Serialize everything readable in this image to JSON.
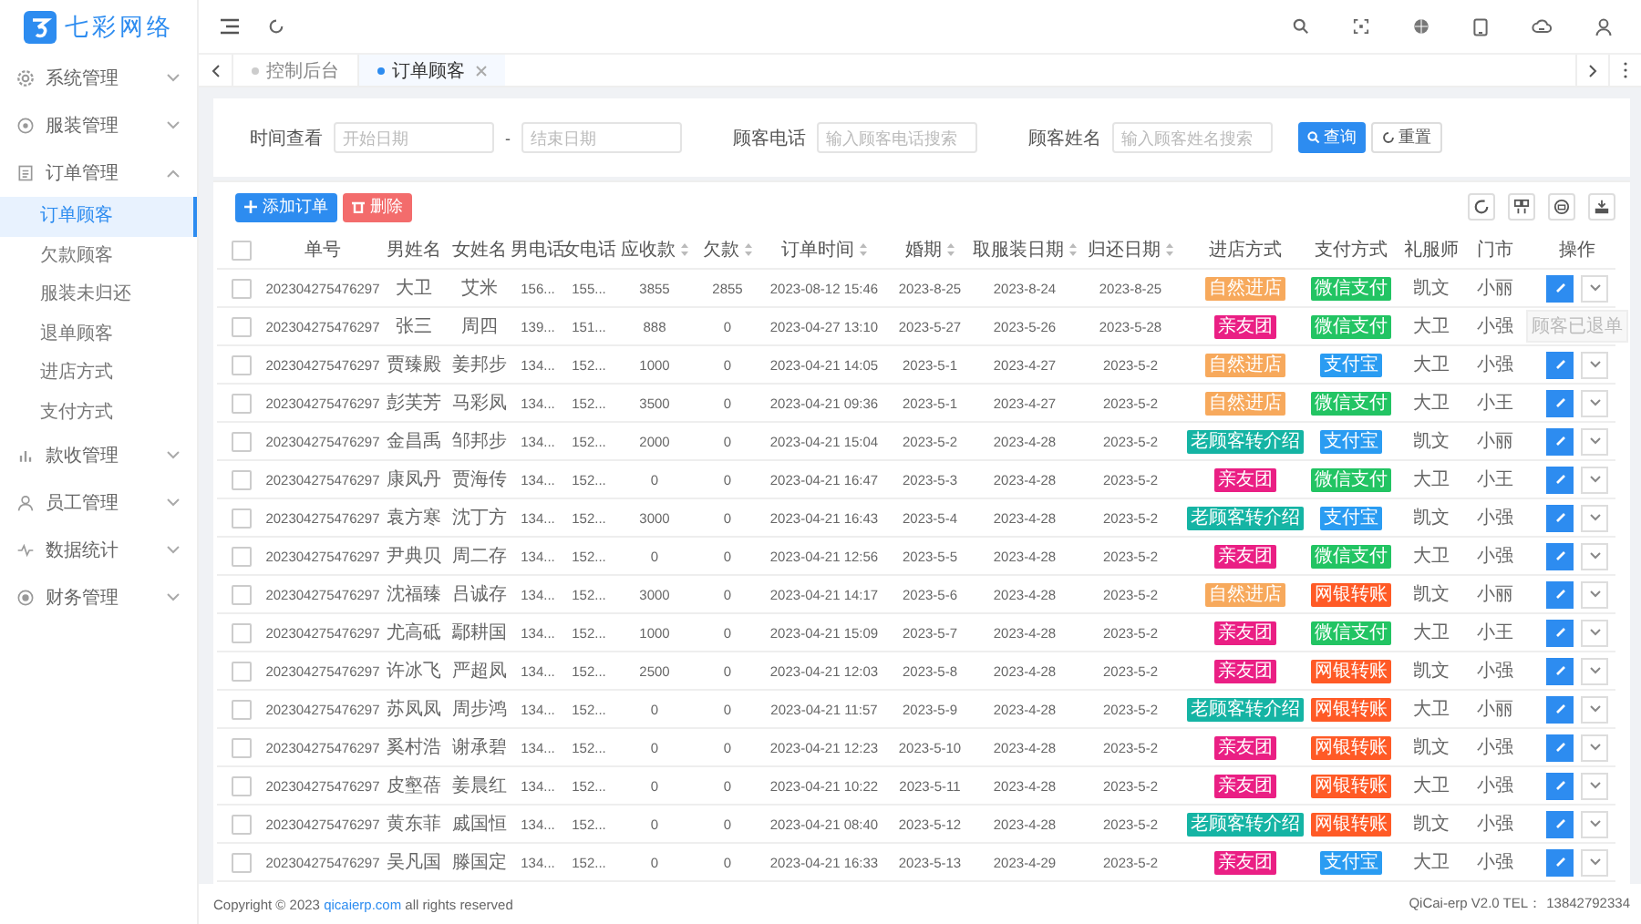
{
  "logo": {
    "text": "七彩网络"
  },
  "sidebar": {
    "items": [
      {
        "label": "系统管理",
        "expanded": false
      },
      {
        "label": "服装管理",
        "expanded": false
      },
      {
        "label": "订单管理",
        "expanded": true,
        "children": [
          {
            "label": "订单顾客",
            "selected": true
          },
          {
            "label": "欠款顾客",
            "selected": false
          },
          {
            "label": "服装未归还",
            "selected": false
          },
          {
            "label": "退单顾客",
            "selected": false
          },
          {
            "label": "进店方式",
            "selected": false
          },
          {
            "label": "支付方式",
            "selected": false
          }
        ]
      },
      {
        "label": "款收管理",
        "expanded": false
      },
      {
        "label": "员工管理",
        "expanded": false
      },
      {
        "label": "数据统计",
        "expanded": false
      },
      {
        "label": "财务管理",
        "expanded": false
      }
    ]
  },
  "tabs": [
    {
      "label": "控制后台",
      "selected": false,
      "closable": false
    },
    {
      "label": "订单顾客",
      "selected": true,
      "closable": true
    }
  ],
  "filters": {
    "date_label": "时间查看",
    "start_placeholder": "开始日期",
    "separator": "-",
    "end_placeholder": "结束日期",
    "phone_label": "顾客电话",
    "phone_placeholder": "输入顾客电话搜索",
    "name_label": "顾客姓名",
    "name_placeholder": "输入顾客姓名搜索",
    "search_button": "查询",
    "reset_button": "重置"
  },
  "toolbar": {
    "buttons": [
      {
        "label": "添加订单",
        "kind": "add"
      },
      {
        "label": "删除",
        "kind": "delete"
      }
    ]
  },
  "table": {
    "select_all_checked": false,
    "columns": [
      {
        "label": "单号",
        "sortable": false
      },
      {
        "label": "男姓名",
        "sortable": false
      },
      {
        "label": "女姓名",
        "sortable": false
      },
      {
        "label": "男电话",
        "sortable": false
      },
      {
        "label": "女电话",
        "sortable": false
      },
      {
        "label": "应收款",
        "sortable": true
      },
      {
        "label": "欠款",
        "sortable": true
      },
      {
        "label": "订单时间",
        "sortable": true
      },
      {
        "label": "婚期",
        "sortable": true
      },
      {
        "label": "取服装日期",
        "sortable": true
      },
      {
        "label": "归还日期",
        "sortable": true
      },
      {
        "label": "进店方式",
        "sortable": false
      },
      {
        "label": "支付方式",
        "sortable": false
      },
      {
        "label": "礼服师",
        "sortable": false
      },
      {
        "label": "门市",
        "sortable": false
      },
      {
        "label": "操作",
        "sortable": false
      }
    ],
    "rows": [
      {
        "checked": false,
        "order_no": "202304275476297",
        "groom": "大卫",
        "bride": "艾米",
        "groom_phone": "156...",
        "bride_phone": "155...",
        "receivable": "3855",
        "owed": "2855",
        "order_time": "2023-08-12 15:46",
        "wedding_date": "2023-8-25",
        "pickup_date": "2023-8-24",
        "return_date": "2023-8-25",
        "visit": {
          "label": "自然进店",
          "color": "#f7a95c"
        },
        "payment": {
          "label": "微信支付",
          "color": "#22c463"
        },
        "stylist": "凯文",
        "store": "小丽",
        "action": {
          "kind": "edit"
        }
      },
      {
        "checked": false,
        "order_no": "202304275476297",
        "groom": "张三",
        "bride": "周四",
        "groom_phone": "139...",
        "bride_phone": "151...",
        "receivable": "888",
        "owed": "0",
        "order_time": "2023-04-27 13:10",
        "wedding_date": "2023-5-27",
        "pickup_date": "2023-5-26",
        "return_date": "2023-5-28",
        "visit": {
          "label": "亲友团",
          "color": "#ea1f84"
        },
        "payment": {
          "label": "微信支付",
          "color": "#22c463"
        },
        "stylist": "大卫",
        "store": "小强",
        "action": {
          "kind": "returned",
          "label": "顾客已退单"
        }
      },
      {
        "checked": false,
        "order_no": "202304275476297",
        "groom": "贾臻殿",
        "bride": "姜邦步",
        "groom_phone": "134...",
        "bride_phone": "152...",
        "receivable": "1000",
        "owed": "0",
        "order_time": "2023-04-21 14:05",
        "wedding_date": "2023-5-1",
        "pickup_date": "2023-4-27",
        "return_date": "2023-5-2",
        "visit": {
          "label": "自然进店",
          "color": "#f7a95c"
        },
        "payment": {
          "label": "支付宝",
          "color": "#2a9cf2"
        },
        "stylist": "大卫",
        "store": "小强",
        "action": {
          "kind": "edit"
        }
      },
      {
        "checked": false,
        "order_no": "202304275476297",
        "groom": "彭芙芳",
        "bride": "马彩凤",
        "groom_phone": "134...",
        "bride_phone": "152...",
        "receivable": "3500",
        "owed": "0",
        "order_time": "2023-04-21 09:36",
        "wedding_date": "2023-5-1",
        "pickup_date": "2023-4-27",
        "return_date": "2023-5-2",
        "visit": {
          "label": "自然进店",
          "color": "#f7a95c"
        },
        "payment": {
          "label": "微信支付",
          "color": "#22c463"
        },
        "stylist": "大卫",
        "store": "小王",
        "action": {
          "kind": "edit"
        }
      },
      {
        "checked": false,
        "order_no": "202304275476297",
        "groom": "金昌禹",
        "bride": "邹邦步",
        "groom_phone": "134...",
        "bride_phone": "152...",
        "receivable": "2000",
        "owed": "0",
        "order_time": "2023-04-21 15:04",
        "wedding_date": "2023-5-2",
        "pickup_date": "2023-4-28",
        "return_date": "2023-5-2",
        "visit": {
          "label": "老顾客转介绍",
          "color": "#15b4a4"
        },
        "payment": {
          "label": "支付宝",
          "color": "#2a9cf2"
        },
        "stylist": "凯文",
        "store": "小丽",
        "action": {
          "kind": "edit"
        }
      },
      {
        "checked": false,
        "order_no": "202304275476297",
        "groom": "康凤丹",
        "bride": "贾海传",
        "groom_phone": "134...",
        "bride_phone": "152...",
        "receivable": "0",
        "owed": "0",
        "order_time": "2023-04-21 16:47",
        "wedding_date": "2023-5-3",
        "pickup_date": "2023-4-28",
        "return_date": "2023-5-2",
        "visit": {
          "label": "亲友团",
          "color": "#ea1f84"
        },
        "payment": {
          "label": "微信支付",
          "color": "#22c463"
        },
        "stylist": "大卫",
        "store": "小王",
        "action": {
          "kind": "edit"
        }
      },
      {
        "checked": false,
        "order_no": "202304275476297",
        "groom": "袁方寒",
        "bride": "沈丁方",
        "groom_phone": "134...",
        "bride_phone": "152...",
        "receivable": "3000",
        "owed": "0",
        "order_time": "2023-04-21 16:43",
        "wedding_date": "2023-5-4",
        "pickup_date": "2023-4-28",
        "return_date": "2023-5-2",
        "visit": {
          "label": "老顾客转介绍",
          "color": "#15b4a4"
        },
        "payment": {
          "label": "支付宝",
          "color": "#2a9cf2"
        },
        "stylist": "凯文",
        "store": "小强",
        "action": {
          "kind": "edit"
        }
      },
      {
        "checked": false,
        "order_no": "202304275476297",
        "groom": "尹典贝",
        "bride": "周二存",
        "groom_phone": "134...",
        "bride_phone": "152...",
        "receivable": "0",
        "owed": "0",
        "order_time": "2023-04-21 12:56",
        "wedding_date": "2023-5-5",
        "pickup_date": "2023-4-28",
        "return_date": "2023-5-2",
        "visit": {
          "label": "亲友团",
          "color": "#ea1f84"
        },
        "payment": {
          "label": "微信支付",
          "color": "#22c463"
        },
        "stylist": "大卫",
        "store": "小强",
        "action": {
          "kind": "edit"
        }
      },
      {
        "checked": false,
        "order_no": "202304275476297",
        "groom": "沈福臻",
        "bride": "吕诚存",
        "groom_phone": "134...",
        "bride_phone": "152...",
        "receivable": "3000",
        "owed": "0",
        "order_time": "2023-04-21 14:17",
        "wedding_date": "2023-5-6",
        "pickup_date": "2023-4-28",
        "return_date": "2023-5-2",
        "visit": {
          "label": "自然进店",
          "color": "#f7a95c"
        },
        "payment": {
          "label": "网银转账",
          "color": "#ff5a26"
        },
        "stylist": "凯文",
        "store": "小丽",
        "action": {
          "kind": "edit"
        }
      },
      {
        "checked": false,
        "order_no": "202304275476297",
        "groom": "尤高砥",
        "bride": "鄢耕国",
        "groom_phone": "134...",
        "bride_phone": "152...",
        "receivable": "1000",
        "owed": "0",
        "order_time": "2023-04-21 15:09",
        "wedding_date": "2023-5-7",
        "pickup_date": "2023-4-28",
        "return_date": "2023-5-2",
        "visit": {
          "label": "亲友团",
          "color": "#ea1f84"
        },
        "payment": {
          "label": "微信支付",
          "color": "#22c463"
        },
        "stylist": "大卫",
        "store": "小王",
        "action": {
          "kind": "edit"
        }
      },
      {
        "checked": false,
        "order_no": "202304275476297",
        "groom": "许冰飞",
        "bride": "严超凤",
        "groom_phone": "134...",
        "bride_phone": "152...",
        "receivable": "2500",
        "owed": "0",
        "order_time": "2023-04-21 12:03",
        "wedding_date": "2023-5-8",
        "pickup_date": "2023-4-28",
        "return_date": "2023-5-2",
        "visit": {
          "label": "亲友团",
          "color": "#ea1f84"
        },
        "payment": {
          "label": "网银转账",
          "color": "#ff5a26"
        },
        "stylist": "凯文",
        "store": "小强",
        "action": {
          "kind": "edit"
        }
      },
      {
        "checked": false,
        "order_no": "202304275476297",
        "groom": "苏凤凤",
        "bride": "周步鸿",
        "groom_phone": "134...",
        "bride_phone": "152...",
        "receivable": "0",
        "owed": "0",
        "order_time": "2023-04-21 11:57",
        "wedding_date": "2023-5-9",
        "pickup_date": "2023-4-28",
        "return_date": "2023-5-2",
        "visit": {
          "label": "老顾客转介绍",
          "color": "#15b4a4"
        },
        "payment": {
          "label": "网银转账",
          "color": "#ff5a26"
        },
        "stylist": "大卫",
        "store": "小丽",
        "action": {
          "kind": "edit"
        }
      },
      {
        "checked": false,
        "order_no": "202304275476297",
        "groom": "奚村浩",
        "bride": "谢承碧",
        "groom_phone": "134...",
        "bride_phone": "152...",
        "receivable": "0",
        "owed": "0",
        "order_time": "2023-04-21 12:23",
        "wedding_date": "2023-5-10",
        "pickup_date": "2023-4-28",
        "return_date": "2023-5-2",
        "visit": {
          "label": "亲友团",
          "color": "#ea1f84"
        },
        "payment": {
          "label": "网银转账",
          "color": "#ff5a26"
        },
        "stylist": "凯文",
        "store": "小强",
        "action": {
          "kind": "edit"
        }
      },
      {
        "checked": false,
        "order_no": "202304275476297",
        "groom": "皮壑蓓",
        "bride": "姜晨红",
        "groom_phone": "134...",
        "bride_phone": "152...",
        "receivable": "0",
        "owed": "0",
        "order_time": "2023-04-21 10:22",
        "wedding_date": "2023-5-11",
        "pickup_date": "2023-4-28",
        "return_date": "2023-5-2",
        "visit": {
          "label": "亲友团",
          "color": "#ea1f84"
        },
        "payment": {
          "label": "网银转账",
          "color": "#ff5a26"
        },
        "stylist": "大卫",
        "store": "小强",
        "action": {
          "kind": "edit"
        }
      },
      {
        "checked": false,
        "order_no": "202304275476297",
        "groom": "黄东菲",
        "bride": "戚国恒",
        "groom_phone": "134...",
        "bride_phone": "152...",
        "receivable": "0",
        "owed": "0",
        "order_time": "2023-04-21 08:40",
        "wedding_date": "2023-5-12",
        "pickup_date": "2023-4-28",
        "return_date": "2023-5-2",
        "visit": {
          "label": "老顾客转介绍",
          "color": "#15b4a4"
        },
        "payment": {
          "label": "网银转账",
          "color": "#ff5a26"
        },
        "stylist": "凯文",
        "store": "小强",
        "action": {
          "kind": "edit"
        }
      },
      {
        "checked": false,
        "order_no": "202304275476297",
        "groom": "吴凡国",
        "bride": "滕国定",
        "groom_phone": "134...",
        "bride_phone": "152...",
        "receivable": "0",
        "owed": "0",
        "order_time": "2023-04-21 16:33",
        "wedding_date": "2023-5-13",
        "pickup_date": "2023-4-29",
        "return_date": "2023-5-2",
        "visit": {
          "label": "亲友团",
          "color": "#ea1f84"
        },
        "payment": {
          "label": "支付宝",
          "color": "#2a9cf2"
        },
        "stylist": "大卫",
        "store": "小强",
        "action": {
          "kind": "edit"
        }
      }
    ]
  },
  "footer": {
    "copyright_before": "Copyright © 2023",
    "link": "qicaierp.com",
    "copyright_after": "all rights reserved",
    "version": "QiCai-erp V2.0 TEL： 13842792334"
  }
}
